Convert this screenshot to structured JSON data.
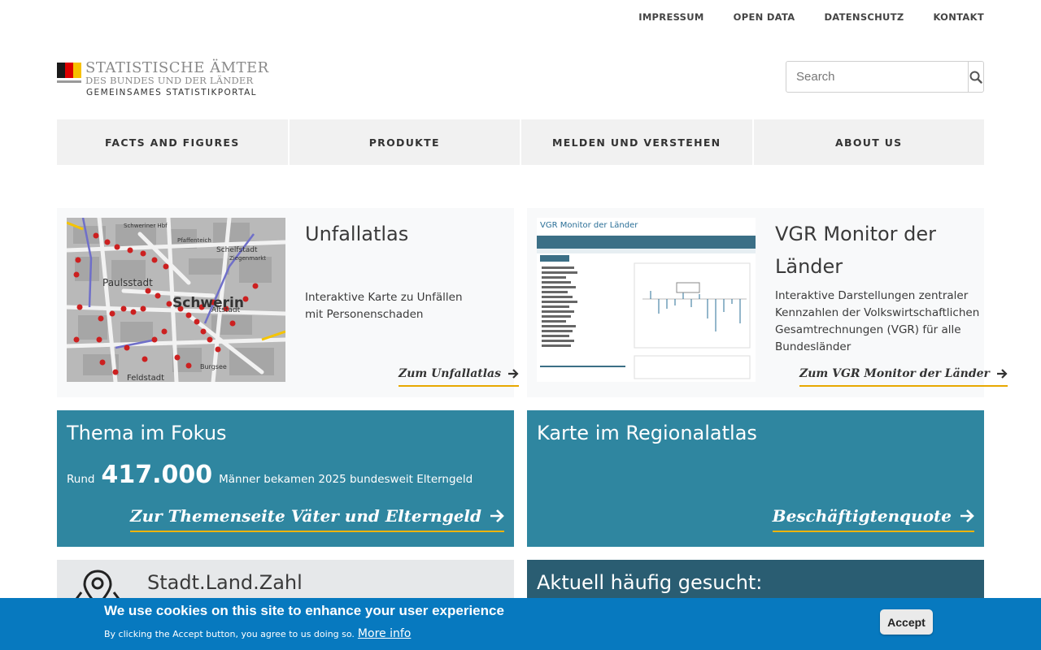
{
  "topnav": {
    "items": [
      "IMPRESSUM",
      "OPEN DATA",
      "DATENSCHUTZ",
      "KONTAKT"
    ]
  },
  "logo": {
    "line1": "STATISTISCHE ÄMTER",
    "line2": "DES BUNDES UND DER LÄNDER",
    "line3": "GEMEINSAMES STATISTIKPORTAL"
  },
  "search": {
    "placeholder": "Search",
    "icon": "search-icon"
  },
  "mainnav": {
    "items": [
      "FACTS AND FIGURES",
      "PRODUKTE",
      "MELDEN UND VERSTEHEN",
      "ABOUT US"
    ]
  },
  "cards": [
    {
      "title": "Unfallatlas",
      "text": "Interaktive Karte zu Unfällen mit Personenschaden",
      "link": "Zum Unfallatlas",
      "image": "map-thumbnail",
      "map_labels": [
        "Schwerin",
        "Paulsstadt",
        "Schelfstadt",
        "Altstadt",
        "Feldstadt",
        "Burgsee",
        "Ziegenmarkt",
        "Pfaffenteich",
        "Schweriner Hbf"
      ]
    },
    {
      "title": "VGR Monitor der Länder",
      "text": "Interaktive Darstellungen zentraler Kennzahlen der Volkswirtschaftlichen Gesamtrechnungen (VGR) für alle Bundesländer",
      "link": "Zum VGR Monitor der Länder",
      "image": "dashboard-screenshot",
      "thumb_title": "VGR Monitor der Länder"
    }
  ],
  "tiles": [
    {
      "title": "Thema im Fokus",
      "fact_prefix": "Rund",
      "fact_number": "417.000",
      "fact_suffix": "Männer bekamen 2025 bundesweit Elterngeld",
      "link": "Zur Themenseite Väter und Elterngeld"
    },
    {
      "title": "Karte im Regionalatlas",
      "link": "Beschäftigtenquote"
    }
  ],
  "bottom": {
    "left_title": "Stadt.Land.Zahl",
    "right_title": "Aktuell häufig gesucht:"
  },
  "cookie": {
    "heading": "We use cookies on this site to enhance your user experience",
    "text": "By clicking the Accept button, you agree to us doing so.",
    "more_info": "More info",
    "accept": "Accept"
  },
  "colors": {
    "tile_blue": "#2f86a0",
    "dark_tile": "#2a5d72",
    "cookie_bar": "#0779bf",
    "link_underline": "#e8a800",
    "card_bg": "#f8f9fa",
    "nav_bg": "#f1f1f1"
  }
}
